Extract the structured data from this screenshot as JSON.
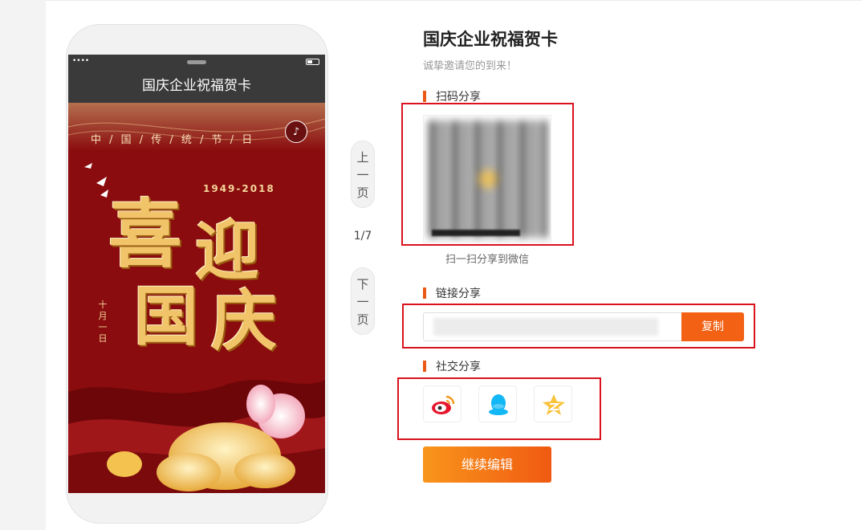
{
  "phone": {
    "status_dots": "••••",
    "title": "国庆企业祝福贺卡",
    "poster": {
      "subtitle": "中 / 国 / 传 / 统 / 节 / 日",
      "years": "1949-2018",
      "line1_a": "喜",
      "line1_b": "迎",
      "line2_a": "国",
      "line2_b": "庆",
      "vertical_date": [
        "十",
        "月",
        "一",
        "日"
      ],
      "music_icon": "music-note-icon"
    }
  },
  "pager": {
    "prev": [
      "上",
      "一",
      "页"
    ],
    "next": [
      "下",
      "一",
      "页"
    ],
    "current": "1/7"
  },
  "panel": {
    "title": "国庆企业祝福贺卡",
    "subtitle": "诚挚邀请您的到来！",
    "scan_section": "扫码分享",
    "scan_caption": "扫一扫分享到微信",
    "link_section": "链接分享",
    "copy_label": "复制",
    "social_section": "社交分享",
    "social_icons": [
      "weibo-icon",
      "qq-icon",
      "qzone-icon"
    ],
    "edit_label": "继续编辑"
  },
  "colors": {
    "accent": "#f26114",
    "highlight_box": "#d9121d",
    "poster_red": "#8a0c0e",
    "gold": "#f1c46a"
  }
}
